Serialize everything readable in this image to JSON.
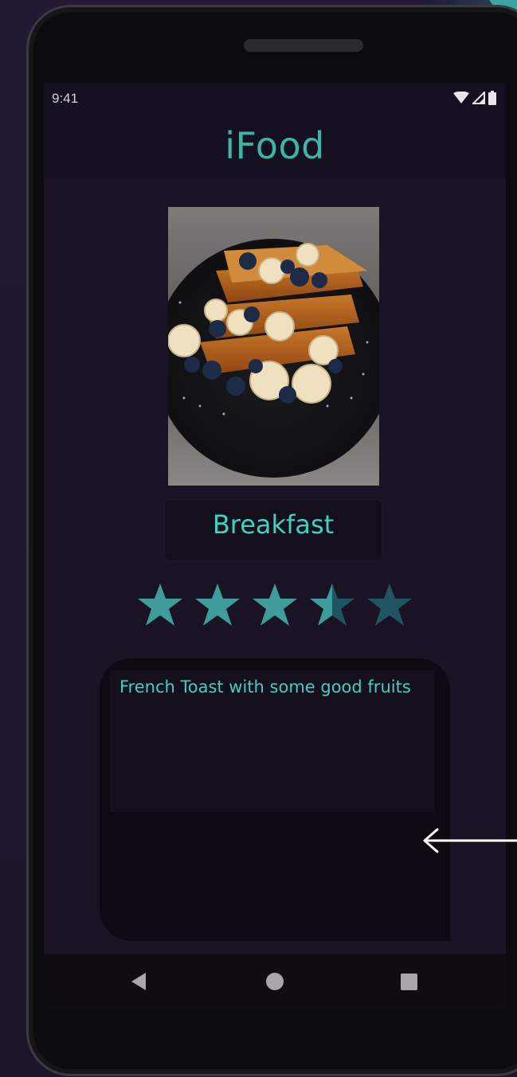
{
  "colors": {
    "accent": "#3fb3a6",
    "text_accent": "#3fd1c0",
    "star_filled": "#3f9c9b",
    "star_empty": "#1f5560",
    "screen_bg": "#1a1324",
    "bar_bg": "#15101f"
  },
  "status_bar": {
    "time": "9:41",
    "icons": [
      "wifi-icon",
      "cellular-signal-icon",
      "battery-icon"
    ]
  },
  "app_bar": {
    "title": "iFood"
  },
  "food": {
    "image_icon": "french-toast-photo",
    "category": "Breakfast",
    "rating": {
      "value": 3.5,
      "max": 5
    },
    "description": "French Toast with some good fruits"
  },
  "nav": {
    "back_icon": "triangle-back-icon",
    "home_icon": "circle-home-icon",
    "recents_icon": "square-recents-icon"
  }
}
